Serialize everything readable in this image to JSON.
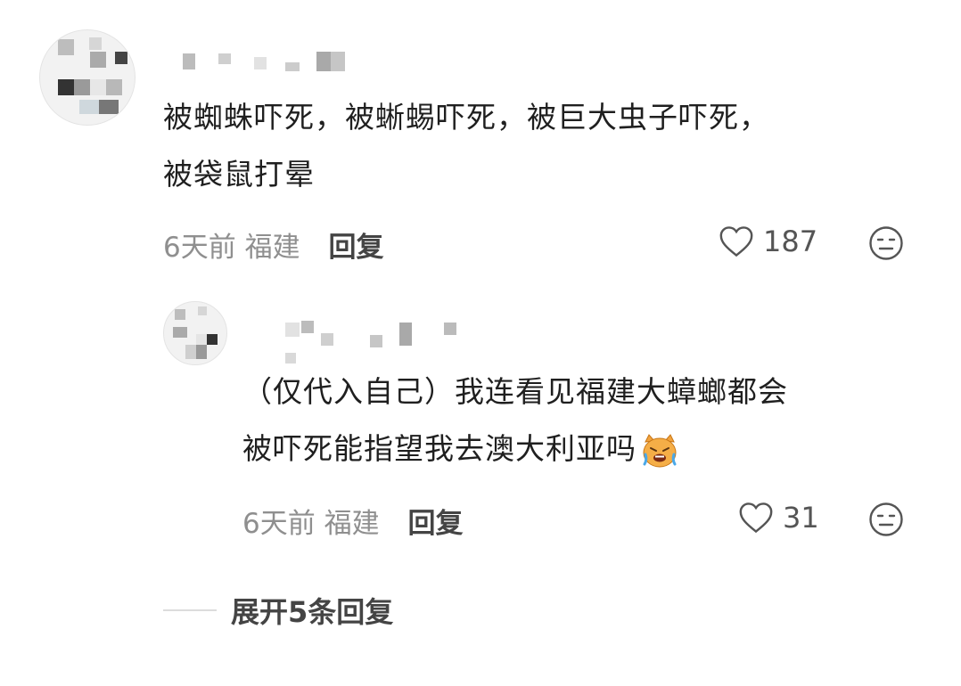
{
  "comments": [
    {
      "text_line1": "被蜘蛛吓死，被蜥蜴吓死，被巨大虫子吓死，",
      "text_line2": "被袋鼠打晕",
      "time": "6天前",
      "location": "福建",
      "reply_label": "回复",
      "likes": "187"
    },
    {
      "text_line1": "（仅代入自己）我连看见福建大蟑螂都会",
      "text_line2": "被吓死能指望我去澳大利亚吗",
      "emoji": "crying-cat-emoji",
      "time": "6天前",
      "location": "福建",
      "reply_label": "回复",
      "likes": "31"
    }
  ],
  "expand_replies_label": "展开5条回复",
  "icons": {
    "like": "heart-outline-icon",
    "reaction": "neutral-face-icon"
  },
  "colors": {
    "text": "#1f1f1f",
    "meta": "#8f8f8f",
    "reply": "#444444"
  }
}
